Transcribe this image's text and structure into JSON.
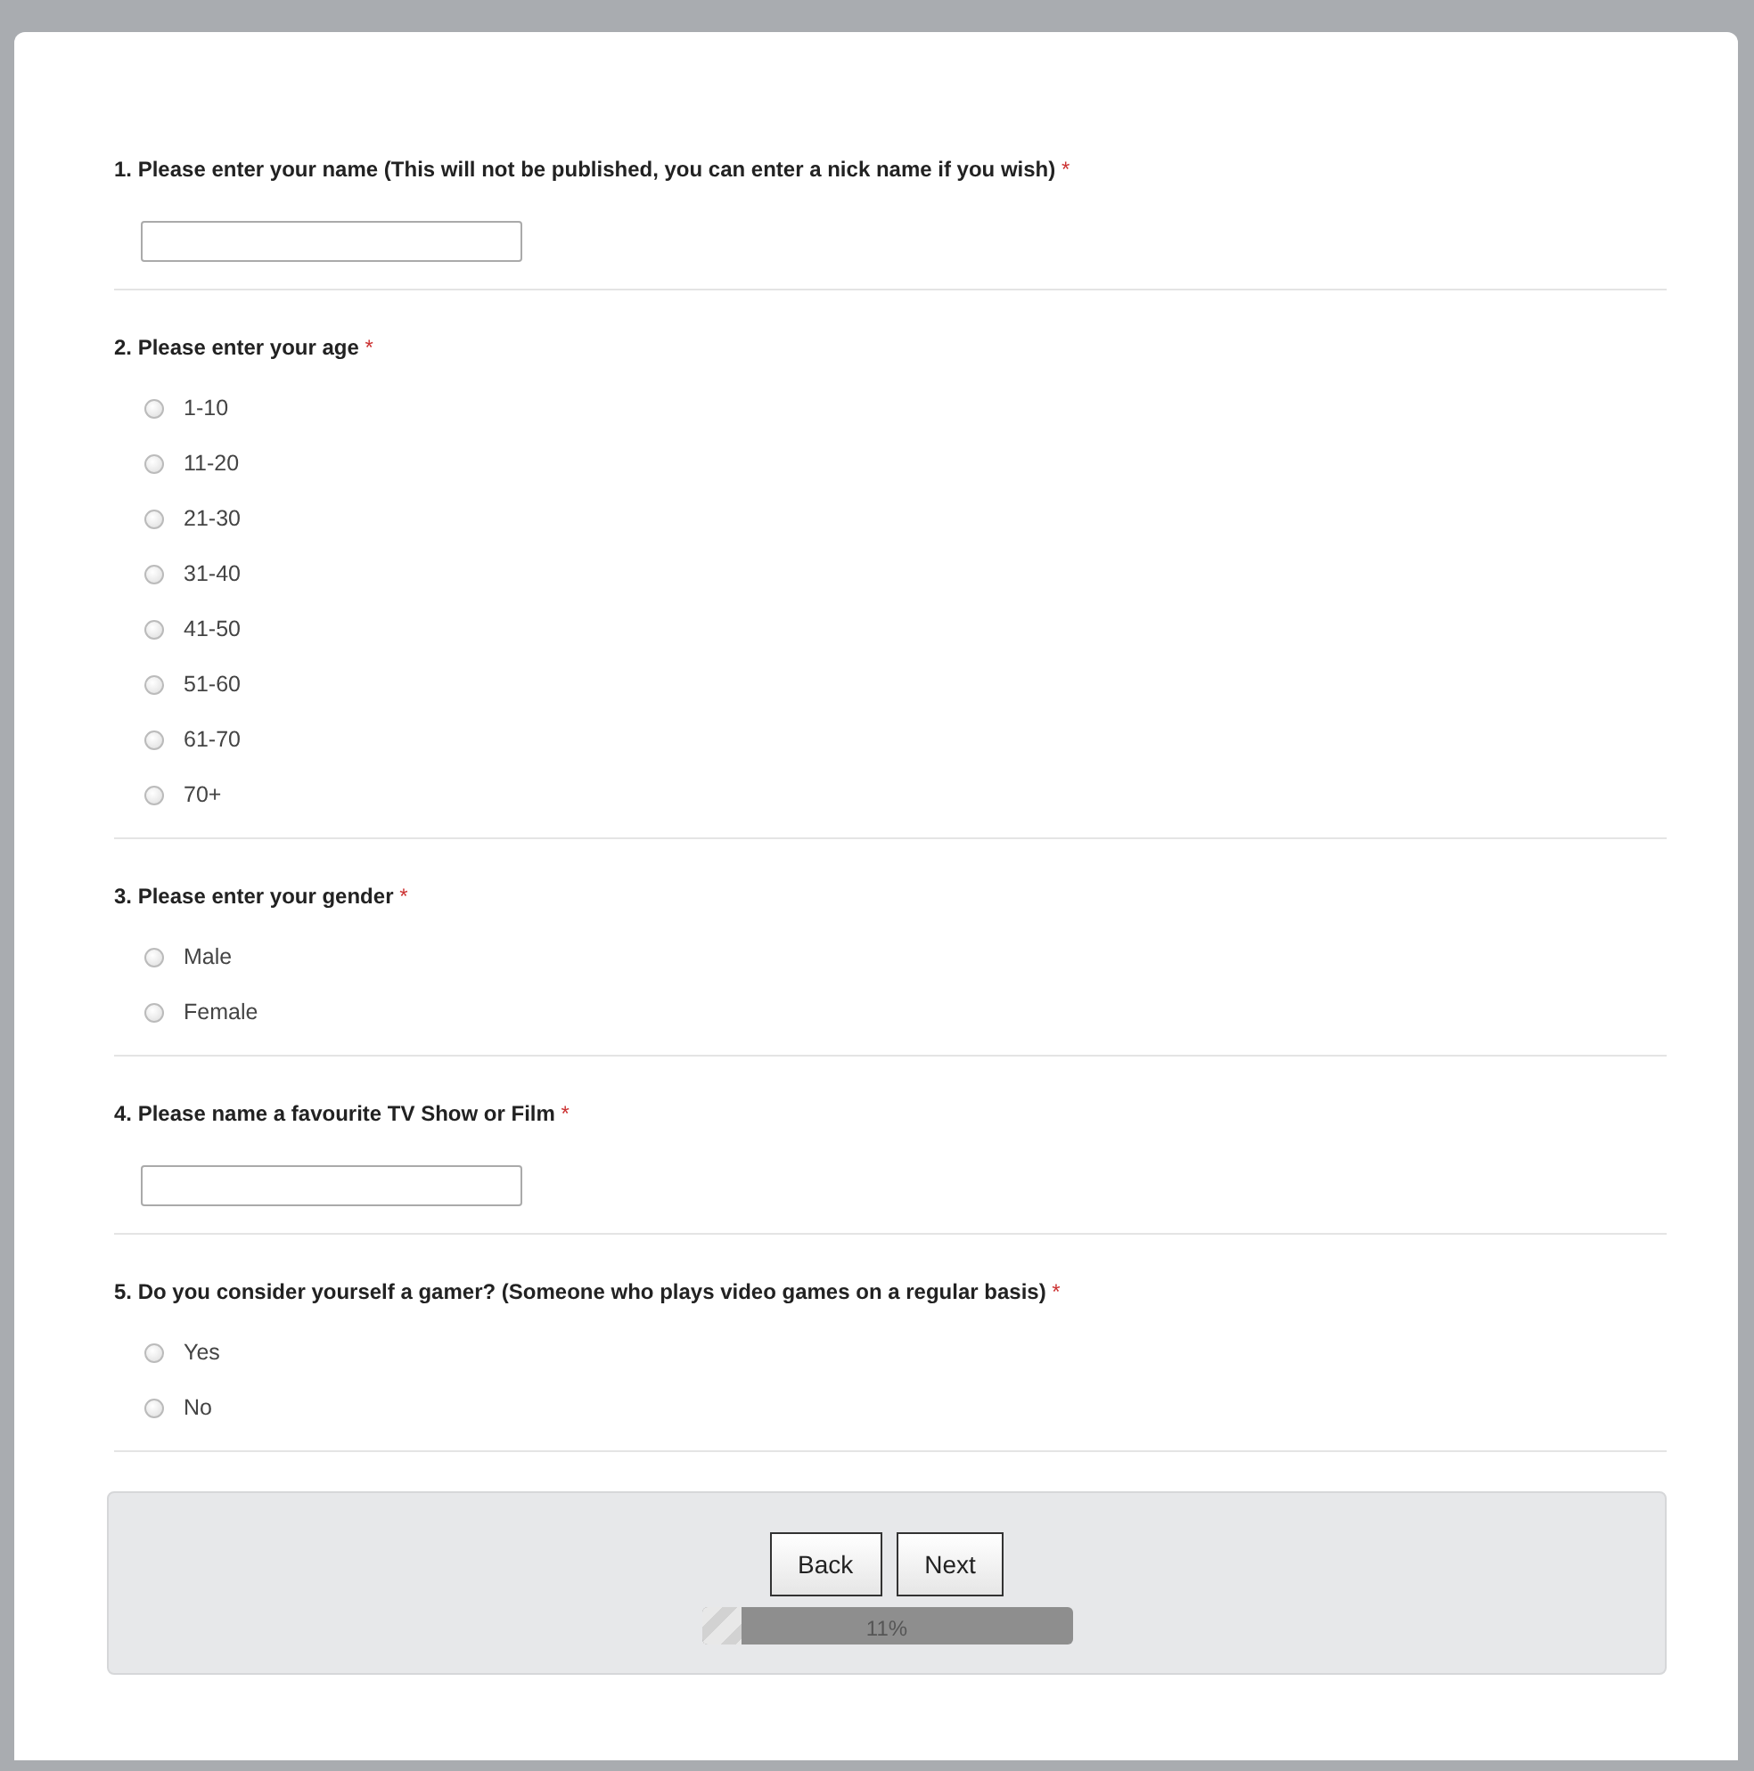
{
  "questions": [
    {
      "number": "1.",
      "title": "Please enter your name (This will not be published, you can enter a nick name if you wish)",
      "required_mark": "*",
      "kind": "text"
    },
    {
      "number": "2.",
      "title": "Please enter your age",
      "required_mark": "*",
      "kind": "radio",
      "options": [
        {
          "label": "1-10",
          "selected": false
        },
        {
          "label": "11-20",
          "selected": false
        },
        {
          "label": "21-30",
          "selected": false
        },
        {
          "label": "31-40",
          "selected": false
        },
        {
          "label": "41-50",
          "selected": false
        },
        {
          "label": "51-60",
          "selected": false
        },
        {
          "label": "61-70",
          "selected": false
        },
        {
          "label": "70+",
          "selected": false
        }
      ]
    },
    {
      "number": "3.",
      "title": "Please enter your gender",
      "required_mark": "*",
      "kind": "radio",
      "options": [
        {
          "label": "Male",
          "selected": false
        },
        {
          "label": "Female",
          "selected": false
        }
      ]
    },
    {
      "number": "4.",
      "title": "Please name a favourite TV Show or Film",
      "required_mark": "*",
      "kind": "text"
    },
    {
      "number": "5.",
      "title": "Do you consider yourself a gamer? (Someone who plays video games on a regular basis)",
      "required_mark": "*",
      "kind": "radio",
      "options": [
        {
          "label": "Yes",
          "selected": false
        },
        {
          "label": "No",
          "selected": false
        }
      ]
    }
  ],
  "buttons": [
    "Back",
    "Next"
  ],
  "progress": {
    "level": 0.11,
    "reading": "11%"
  }
}
